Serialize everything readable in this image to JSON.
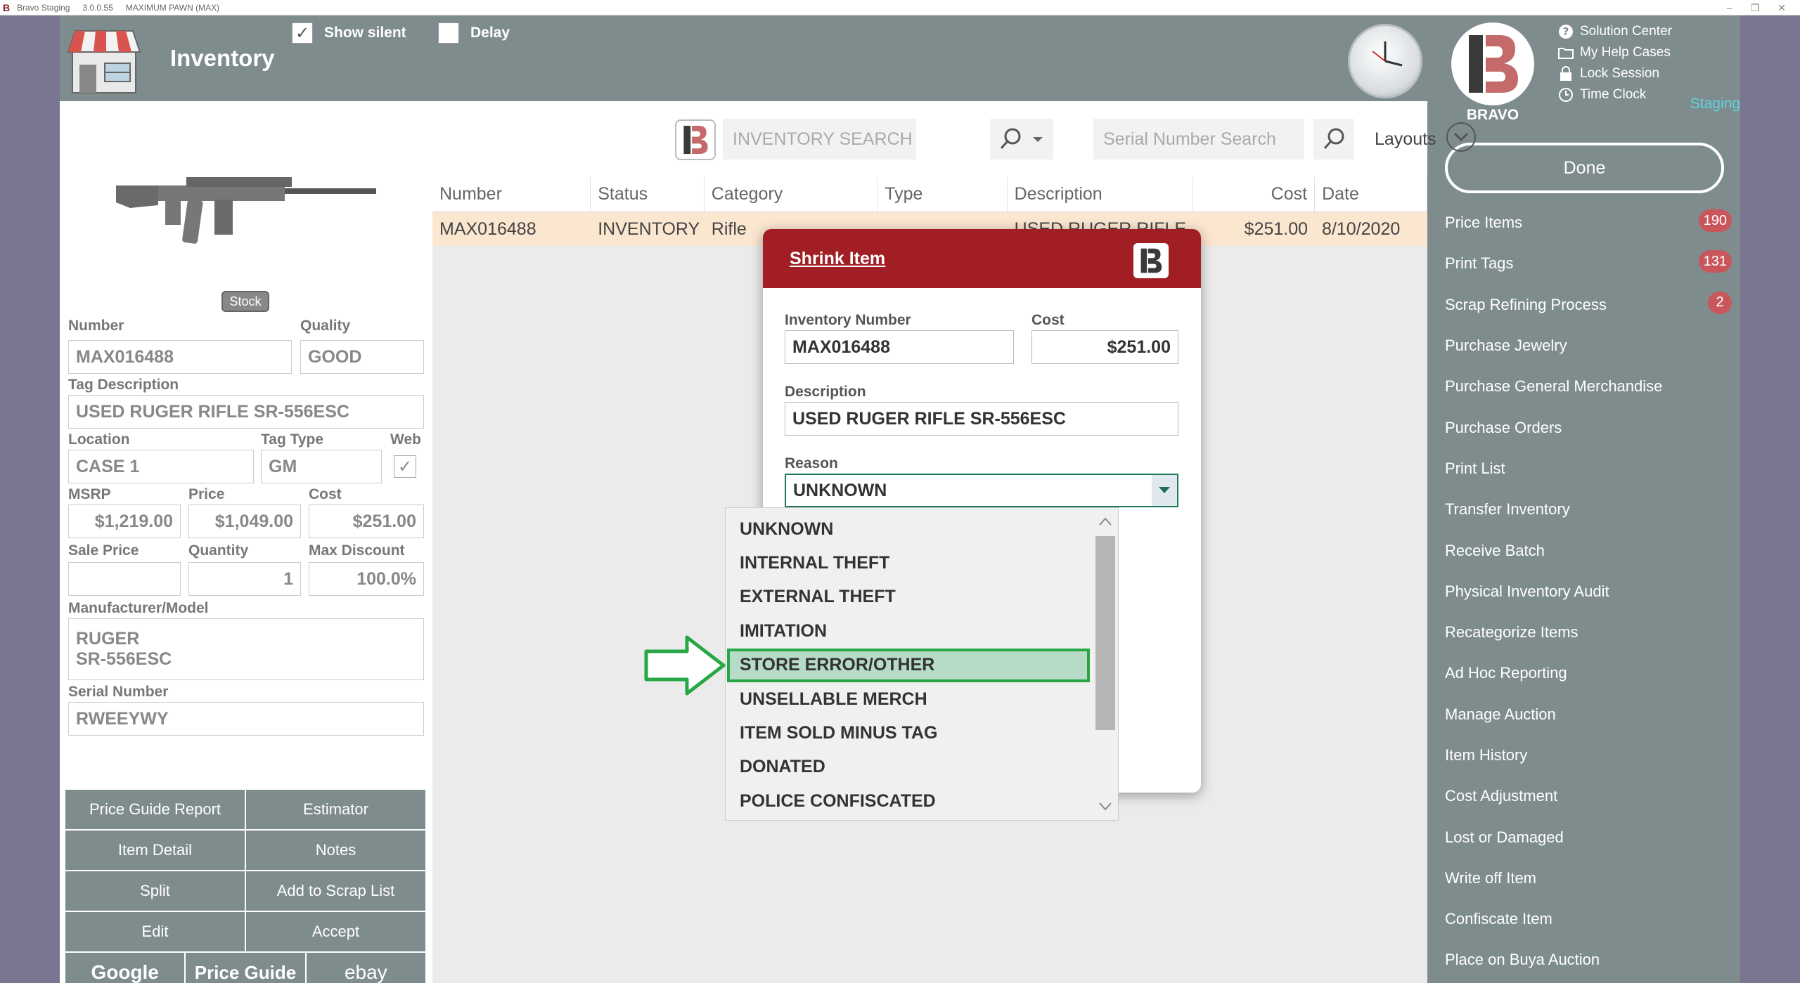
{
  "titlebar": {
    "app": "Bravo Staging",
    "version": "3.0.0.55",
    "store": "MAXIMUM PAWN (MAX)"
  },
  "header": {
    "title": "Inventory",
    "show_silent_label": "Show silent",
    "show_silent_checked": true,
    "delay_label": "Delay",
    "delay_checked": false
  },
  "right_panel": {
    "brand": "BRAVO",
    "staging": "Staging",
    "help_links": [
      "Solution Center",
      "My Help Cases",
      "Lock Session",
      "Time Clock"
    ],
    "done_label": "Done",
    "actions": [
      {
        "label": "Price Items",
        "badge": "190"
      },
      {
        "label": "Print Tags",
        "badge": "131"
      },
      {
        "label": "Scrap Refining Process",
        "badge": "2"
      },
      {
        "label": "Purchase Jewelry",
        "badge": ""
      },
      {
        "label": "Purchase General Merchandise",
        "badge": ""
      },
      {
        "label": "Purchase Orders",
        "badge": ""
      },
      {
        "label": "Print List",
        "badge": ""
      },
      {
        "label": "Transfer Inventory",
        "badge": ""
      },
      {
        "label": "Receive Batch",
        "badge": ""
      },
      {
        "label": "Physical Inventory Audit",
        "badge": ""
      },
      {
        "label": "Recategorize Items",
        "badge": ""
      },
      {
        "label": "Ad Hoc Reporting",
        "badge": ""
      },
      {
        "label": "Manage Auction",
        "badge": ""
      },
      {
        "label": "Item History",
        "badge": ""
      },
      {
        "label": "Cost Adjustment",
        "badge": ""
      },
      {
        "label": "Lost or Damaged",
        "badge": ""
      },
      {
        "label": "Write off Item",
        "badge": ""
      },
      {
        "label": "Confiscate Item",
        "badge": ""
      },
      {
        "label": "Place on Buya Auction",
        "badge": ""
      }
    ]
  },
  "search": {
    "inventory_placeholder": "INVENTORY SEARCH",
    "serial_placeholder": "Serial Number Search",
    "layouts_label": "Layouts"
  },
  "grid": {
    "columns": [
      "Number",
      "Status",
      "Category",
      "Type",
      "Description",
      "Cost",
      "Date"
    ],
    "rows": [
      [
        "MAX016488",
        "INVENTORY",
        "Rifle",
        "",
        "USED RUGER RIFLE...",
        "$251.00",
        "8/10/2020"
      ]
    ]
  },
  "item": {
    "stock_label": "Stock",
    "number_label": "Number",
    "number": "MAX016488",
    "quality_label": "Quality",
    "quality": "GOOD",
    "tag_desc_label": "Tag Description",
    "tag_desc": "USED RUGER RIFLE SR-556ESC",
    "location_label": "Location",
    "location": "CASE 1",
    "tag_type_label": "Tag Type",
    "tag_type": "GM",
    "web_label": "Web",
    "msrp_label": "MSRP",
    "msrp": "$1,219.00",
    "price_label": "Price",
    "price": "$1,049.00",
    "cost_label": "Cost",
    "cost": "$251.00",
    "sale_price_label": "Sale Price",
    "sale_price": "",
    "quantity_label": "Quantity",
    "quantity": "1",
    "max_discount_label": "Max Discount",
    "max_discount": "100.0%",
    "mfr_label": "Manufacturer/Model",
    "mfr_line1": "RUGER",
    "mfr_line2": "SR-556ESC",
    "serial_label": "Serial Number",
    "serial": "RWEEYWY"
  },
  "left_buttons": {
    "price_guide_report": "Price Guide Report",
    "estimator": "Estimator",
    "item_detail": "Item Detail",
    "notes": "Notes",
    "split": "Split",
    "add_scrap": "Add to Scrap List",
    "edit": "Edit",
    "accept": "Accept",
    "google": "Google",
    "price_guide": "Price Guide",
    "ebay": "ebay"
  },
  "dialog": {
    "title": "Shrink Item",
    "inv_number_label": "Inventory Number",
    "inv_number": "MAX016488",
    "cost_label": "Cost",
    "cost": "$251.00",
    "description_label": "Description",
    "description": "USED RUGER RIFLE SR-556ESC",
    "reason_label": "Reason",
    "reason": "UNKNOWN",
    "reason_options": [
      "UNKNOWN",
      "INTERNAL THEFT",
      "EXTERNAL THEFT",
      "IMITATION",
      "STORE ERROR/OTHER",
      "UNSELLABLE MERCH",
      "ITEM SOLD MINUS TAG",
      "DONATED",
      "POLICE CONFISCATED"
    ],
    "highlighted_option": "STORE ERROR/OTHER"
  },
  "colors": {
    "header": "#7f8c8d",
    "dialog_head": "#a11f24",
    "highlight": "#27a744",
    "badge": "#c9565c"
  }
}
